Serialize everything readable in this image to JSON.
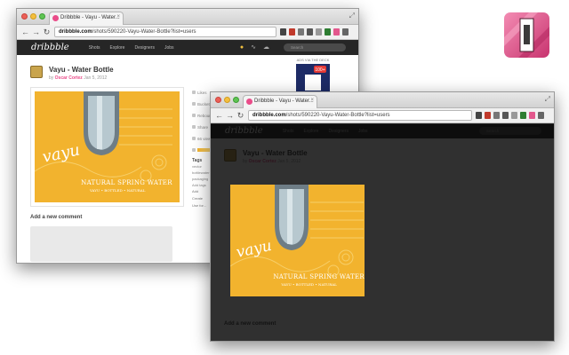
{
  "extension_icon": {
    "name": "lights-off-extension-icon",
    "color": "#e3588d"
  },
  "back_window": {
    "tab": {
      "title": "Dribbble - Vayu - Water...",
      "close": "×"
    },
    "url": {
      "domain": "dribbble.com",
      "path": "/shots/590220-Vayu-Water-Bottle?list=users"
    },
    "nav": {
      "logo": "dribbble",
      "links": [
        "Shots",
        "Explore",
        "Designers",
        "Jobs"
      ],
      "search_placeholder": "Search"
    },
    "shot": {
      "title": "Vayu - Water Bottle",
      "by": "by",
      "author": "Oscar Cortez",
      "date": "Jan 5, 2012"
    },
    "ad_label": "ADS VIA THE DECK",
    "sidebar": {
      "rows": [
        "Likes",
        "Bucket",
        "Rebound",
        "Share",
        "66 views",
        ""
      ],
      "tags_heading": "Tags",
      "tags": [
        "vector",
        "bottlewater",
        "packaging"
      ],
      "add_tags": "Add tags",
      "tools": [
        "Add",
        "Create",
        "Use for..."
      ]
    },
    "comment_heading": "Add a new comment"
  },
  "front_window": {
    "tab": {
      "title": "Dribbble - Vayu - Water...",
      "close": "×"
    },
    "url": {
      "domain": "dribbble.com",
      "path": "/shots/590220-Vayu-Water-Bottle?list=users"
    },
    "nav": {
      "logo": "dribbble",
      "links": [
        "Shots",
        "Explore",
        "Designers",
        "Jobs"
      ],
      "search_placeholder": "Search"
    },
    "shot": {
      "title": "Vayu - Water Bottle",
      "by": "by",
      "author": "Oscar Cortez",
      "date": "Jan 5, 2012"
    },
    "comment_heading": "Add a new comment"
  },
  "artwork": {
    "brand": "vayu",
    "caption_main": "NATURAL SPRING WATER",
    "caption_sub": "VAYU • BOTTLED • NATURAL",
    "background": "#f2b32e"
  }
}
